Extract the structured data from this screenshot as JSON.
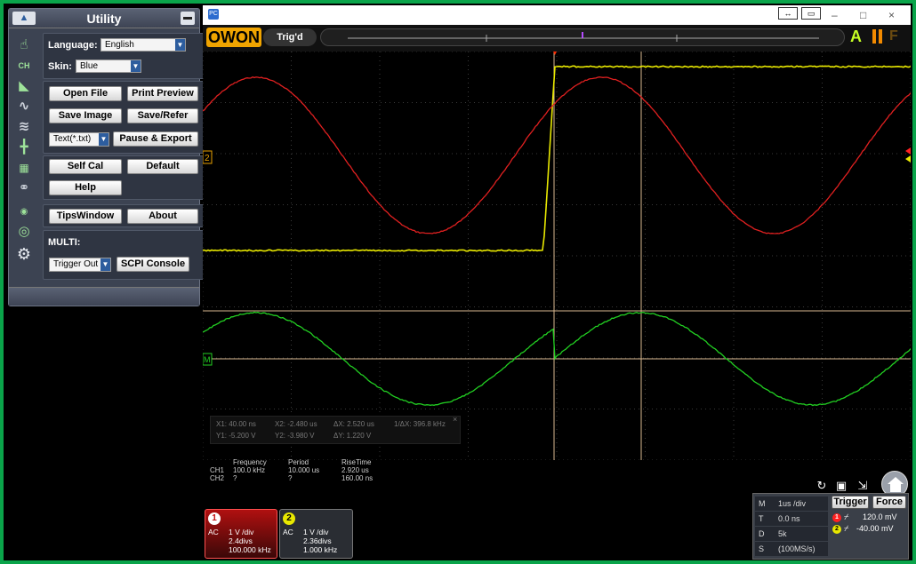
{
  "colors": {
    "ch1": "#e8e800",
    "ch2": "#e02020",
    "math": "#22d022",
    "panel": "#3c4352",
    "frame": "#0aa44a",
    "cursor": "#d9b88f"
  },
  "utility": {
    "title": "Utility",
    "language_label": "Language:",
    "language_value": "English",
    "skin_label": "Skin:",
    "skin_value": "Blue",
    "buttons": {
      "open_file": "Open File",
      "print_preview": "Print Preview",
      "save_image": "Save Image",
      "save_refer": "Save/Refer",
      "pause_export": "Pause & Export",
      "self_cal": "Self Cal",
      "default": "Default",
      "help": "Help",
      "tips_window": "TipsWindow",
      "about": "About",
      "scpi_console": "SCPI Console"
    },
    "export_format": "Text(*.txt)",
    "multi_label": "MULTI:",
    "multi_value": "Trigger Out",
    "side_icons": [
      "hand-icon",
      "channel-icon",
      "ruler-icon",
      "math-wave-icon",
      "fft-icon",
      "crosshair-icon",
      "measure-icon",
      "link-icon",
      "toggle-icon",
      "record-icon",
      "settings-gear-icon"
    ]
  },
  "window": {
    "toolbar": {
      "logo": "OWON",
      "trigger_state": "Trig'd",
      "auto_label": "A",
      "force_label": "F"
    },
    "controls": {
      "minimize": "–",
      "maximize": "□",
      "close": "×"
    },
    "titlebar_buttons": [
      "↔",
      "▭"
    ]
  },
  "cursor_readout": {
    "x1": "X1: 40.00 ns",
    "x2": "X2: -2.480 us",
    "dx": "ΔX: 2.520 us",
    "inv_dx": "1/ΔX: 396.8 kHz",
    "y1": "Y1: -5.200 V",
    "y2": "Y2: -3.980 V",
    "dy": "ΔY: 1.220 V",
    "close": "×"
  },
  "measurements": {
    "headers": [
      "Frequency",
      "Period",
      "RiseTime"
    ],
    "rows": [
      {
        "ch": "CH1",
        "frequency": "100.0 kHz",
        "period": "10.000 us",
        "risetime": "2.920 us"
      },
      {
        "ch": "CH2",
        "frequency": "?",
        "period": "?",
        "risetime": "160.00 ns"
      }
    ]
  },
  "channels": [
    {
      "num": "1",
      "coupling": "AC",
      "vdiv": "1 V /div",
      "offset": "2.4divs",
      "freq": "100.000 kHz"
    },
    {
      "num": "2",
      "coupling": "AC",
      "vdiv": "1 V /div",
      "offset": "2.36divs",
      "freq": "1.000 kHz"
    }
  ],
  "timebase": {
    "m_label": "M",
    "m_value": "1us /div",
    "t_label": "T",
    "t_value": "0.0 ns",
    "d_label": "D",
    "d_value": "5k",
    "s_label": "S",
    "s_value": "(100MS/s)"
  },
  "trigger": {
    "trigger_label": "Trigger",
    "force_label": "Force",
    "ch1_level": "120.0 mV",
    "ch2_level": "-40.00 mV"
  },
  "markers": {
    "ch2": "2",
    "math": "M"
  }
}
